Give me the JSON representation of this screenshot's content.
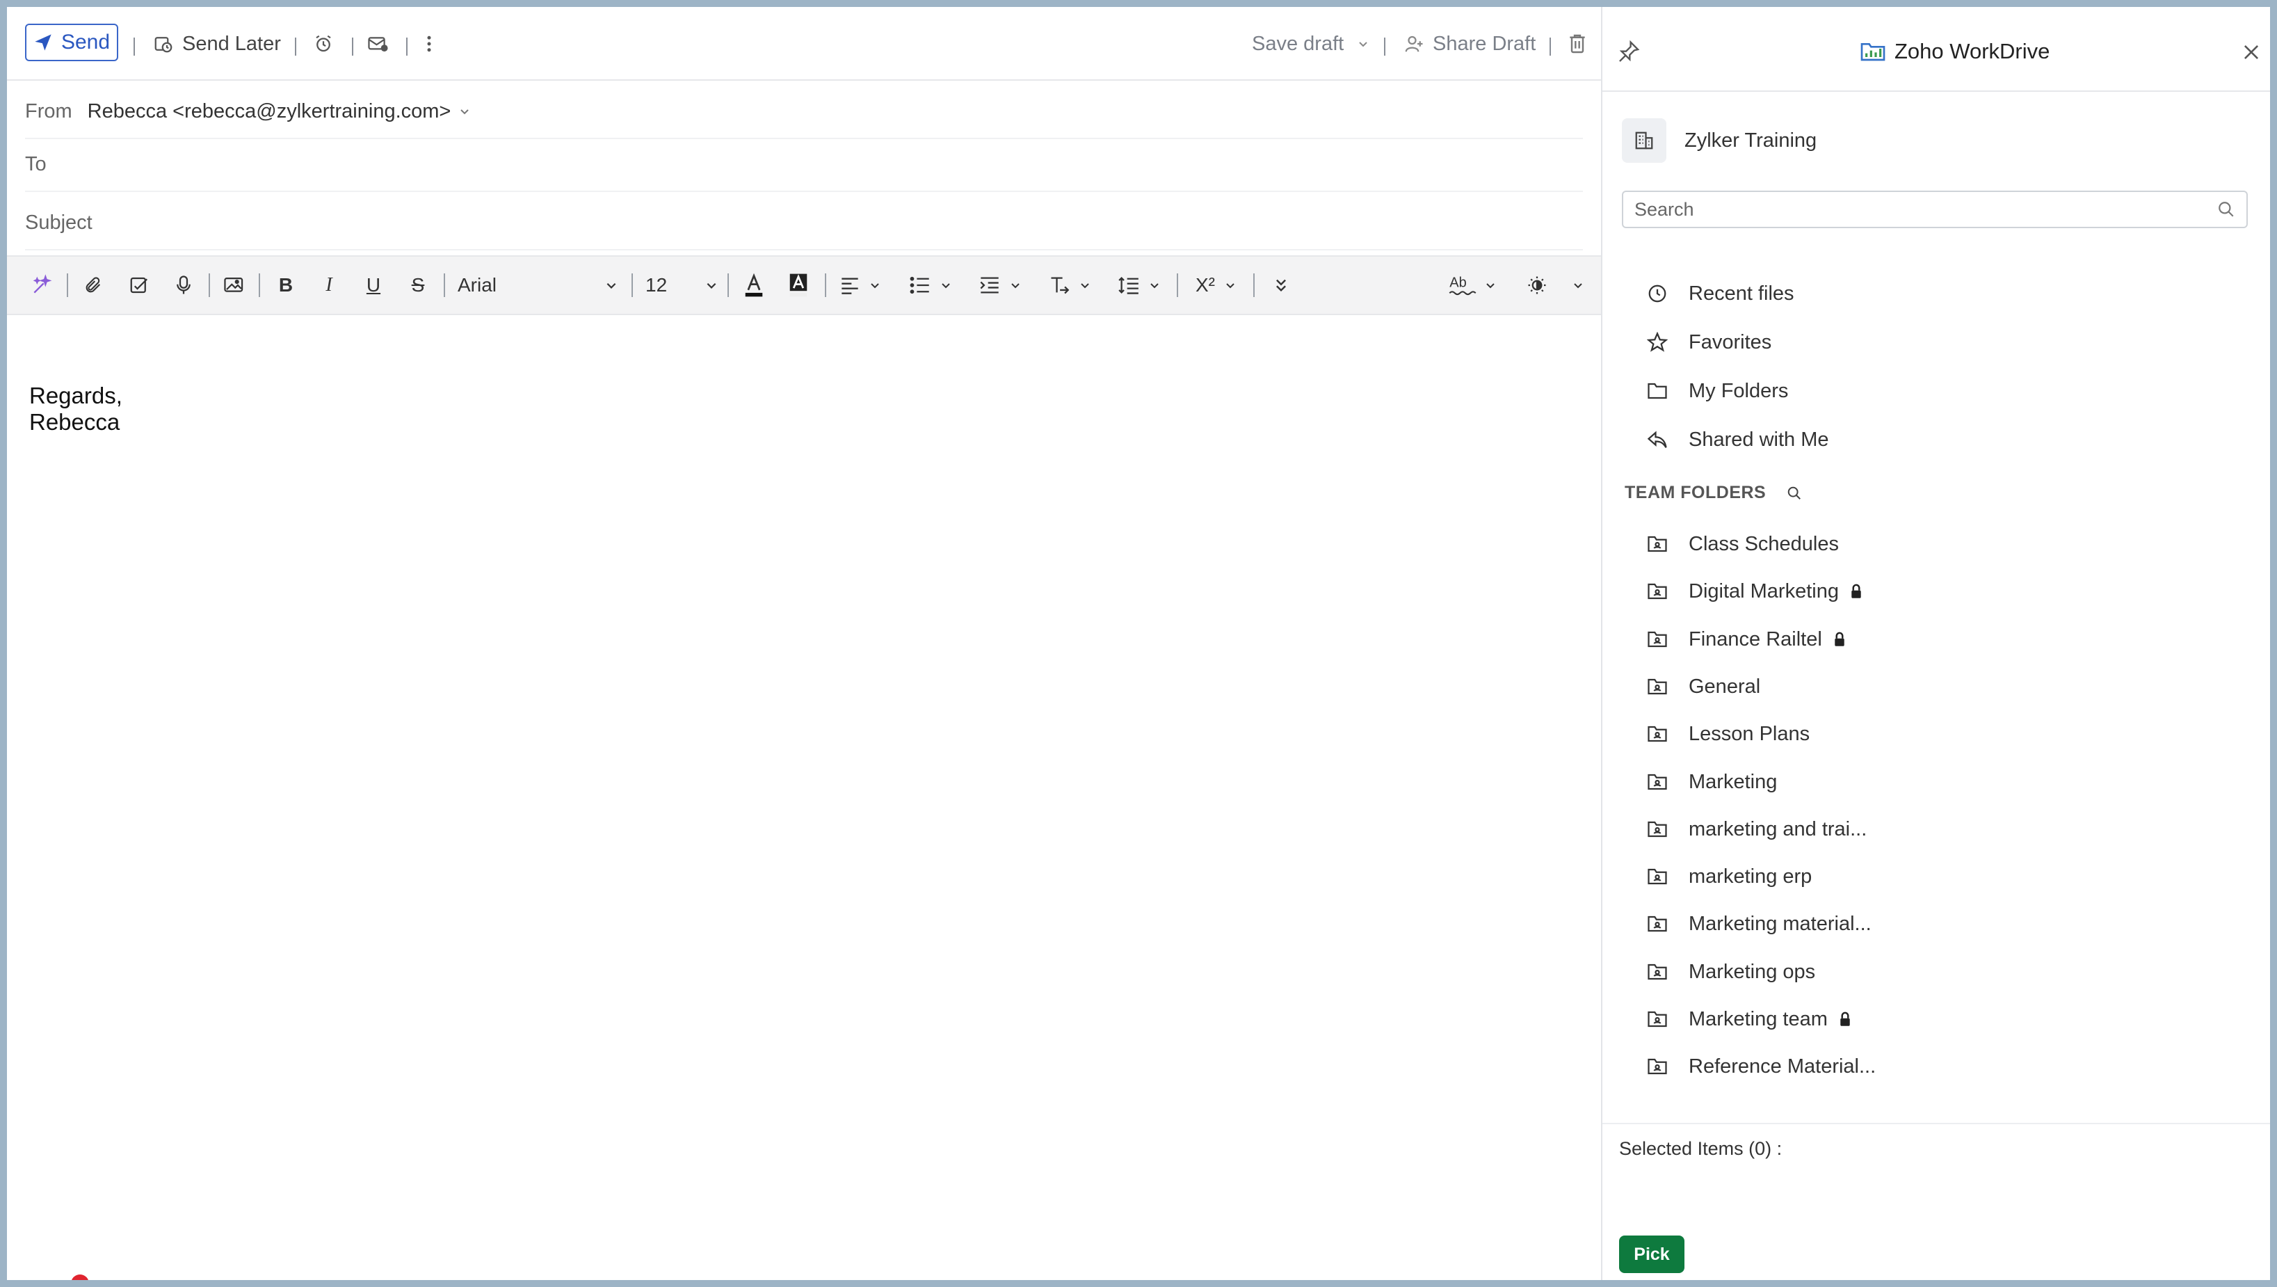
{
  "toolbar": {
    "send_label": "Send",
    "send_later_label": "Send Later",
    "save_draft_label": "Save draft",
    "share_draft_label": "Share Draft"
  },
  "fields": {
    "from_label": "From",
    "from_value": "Rebecca <rebecca@zylkertraining.com>",
    "to_label": "To",
    "subject_label": "Subject"
  },
  "format": {
    "font_family": "Arial",
    "font_size": "12"
  },
  "body": {
    "line1": "Regards,",
    "line2": "Rebecca"
  },
  "panel": {
    "title": "Zoho WorkDrive",
    "org_name": "Zylker Training",
    "search_placeholder": "Search",
    "nav": [
      {
        "label": "Recent files",
        "icon": "clock-icon"
      },
      {
        "label": "Favorites",
        "icon": "star-icon"
      },
      {
        "label": "My Folders",
        "icon": "folder-icon"
      },
      {
        "label": "Shared with Me",
        "icon": "shared-icon"
      }
    ],
    "team_folders_label": "TEAM FOLDERS",
    "folders": [
      {
        "label": "Class Schedules",
        "locked": false
      },
      {
        "label": "Digital Marketing",
        "locked": true
      },
      {
        "label": "Finance Railtel",
        "locked": true
      },
      {
        "label": "General",
        "locked": false
      },
      {
        "label": "Lesson Plans",
        "locked": false
      },
      {
        "label": "Marketing",
        "locked": false
      },
      {
        "label": "marketing and trai...",
        "locked": false
      },
      {
        "label": "marketing erp",
        "locked": false
      },
      {
        "label": "Marketing material...",
        "locked": false
      },
      {
        "label": "Marketing ops",
        "locked": false
      },
      {
        "label": "Marketing team",
        "locked": true
      },
      {
        "label": "Reference Material...",
        "locked": false
      }
    ],
    "selected_items": "Selected Items (0) :",
    "pick_label": "Pick"
  },
  "colors": {
    "accent": "#2a57c0",
    "pick_green": "#0e7a3e",
    "frame_bg": "#9db4c6"
  }
}
